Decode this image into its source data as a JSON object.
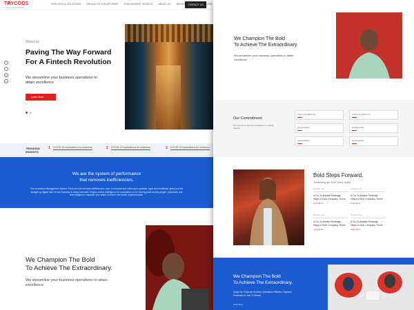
{
  "nav": {
    "logo_text": "TRYCODS",
    "logo_tagline": "A TECH SOLUTIONS",
    "links": [
      "SERVICES & SOLUTIONS",
      "PRODUCTS & PLATFORMS",
      "ENGAGEMENT MODELS",
      "ABOUT US",
      "INSIGHTS",
      "INTEGRATIONS"
    ],
    "contact_label": "CONTACT US"
  },
  "hero": {
    "eyebrow": "About us",
    "title_line1": "Paving The Way Forward",
    "title_line2": "For A Fintech Revolution",
    "subtitle": "We streamline your business operations to attain excellence",
    "button": "Learn More",
    "side_icons": [
      "f",
      "t",
      "in",
      "ig"
    ]
  },
  "insights": {
    "label_line1": "TRENDING",
    "label_line2": "INSIGHTS",
    "items": [
      {
        "num": "1",
        "text": "COVID-19 implications for business"
      },
      {
        "num": "2",
        "text": "COVID-19 implications for business"
      },
      {
        "num": "3",
        "text": "COVID-19 implications for business"
      }
    ]
  },
  "band": {
    "title_line1": "We are the system of performance",
    "title_line2": "that removes inefficiencies.",
    "text": "Our Innovation Management System Think and Act removes inefficiencies, fast. It connects and unites your systems, apps and workflows, gives you the straight-up digital truth of how business is being executed. Engine-centric intelligence for automation of the moving parts across people, processes and technologies to empower your teams to reach new levels of performance."
  },
  "champion": {
    "title_line1": "We Champion The Bold",
    "title_line2": "To Achieve The Extraordinary.",
    "subtitle": "We streamline your business operations to attain excellence"
  },
  "right_champion": {
    "title_line1": "We Champion The Bold",
    "title_line2": "To Achieve The Extraordinary.",
    "subtitle": "We streamline your business operations to attain excellence"
  },
  "commitment": {
    "title": "Our Commitment",
    "text": "We commit to improve operations in a timely manner",
    "cards": [
      "Improving Efficiency",
      "Improving Efficiency",
      "Sustainability",
      "Sustainability",
      "Sustainability",
      "Sustainability"
    ]
  },
  "bold_steps": {
    "title": "Bold Steps Forward.",
    "subtitle": "Celebrating two TrueCode's stories",
    "products": [
      {
        "label": "Product Line",
        "text": "A Go-To-Market Redesign Helps A Tech Company Thrive",
        "link": "Learn More"
      },
      {
        "label": "Product Line",
        "text": "A Go-To-Market Redesign Helps A Tech Company Thrive",
        "link": "Learn More"
      },
      {
        "label": "Product Line",
        "text": "A Go-To-Market Redesign Helps A Tech Company Thrive",
        "link": "Learn More"
      },
      {
        "label": "Product Line",
        "text": "A Go-To-Market Redesign Helps A Tech Company Thrive",
        "link": "Learn More"
      }
    ]
  },
  "right_blue": {
    "title_line1": "We Champion The Bold",
    "title_line2": "To Achieve The Extraordinary.",
    "text": "Using Our Financial Services Operations Platform, Payment Processes in Just 72 Weeks",
    "link": "Learn More"
  },
  "colors": {
    "accent": "#e02020",
    "brand_blue": "#1a5bd0"
  }
}
